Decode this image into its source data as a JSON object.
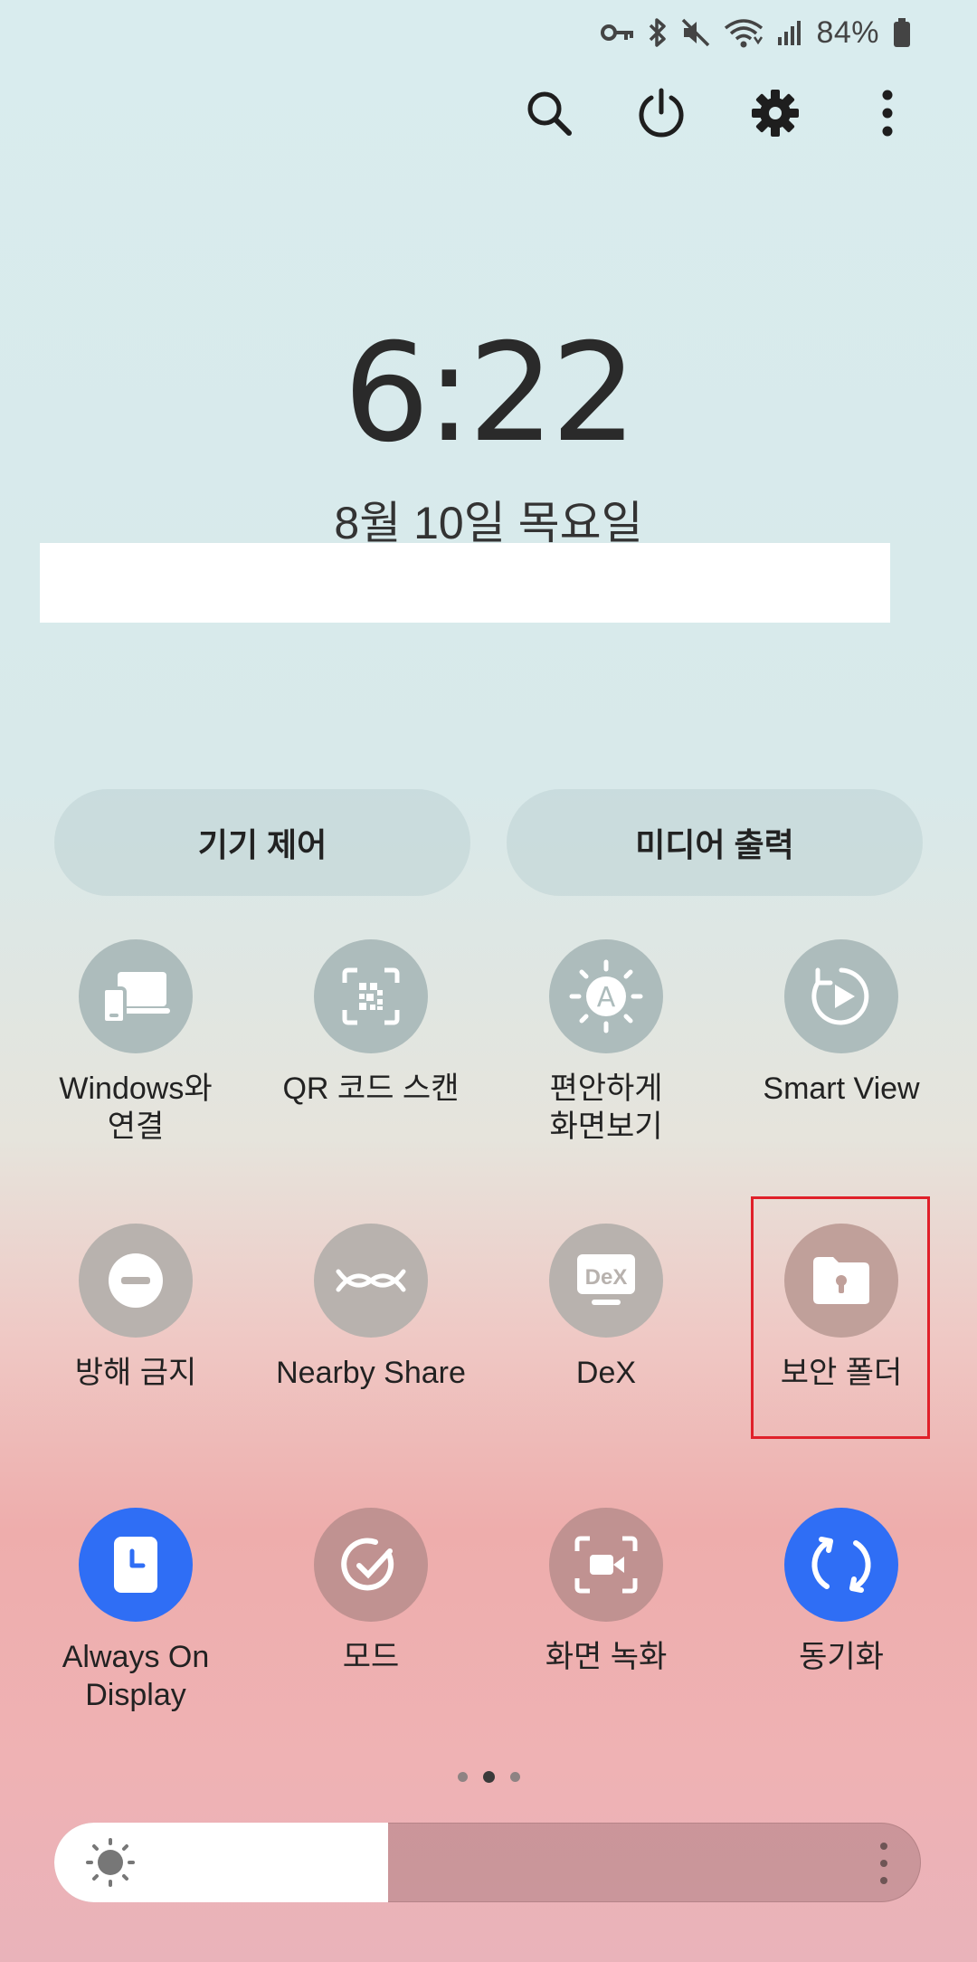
{
  "status_bar": {
    "battery_text": "84%",
    "icons": [
      "key-icon",
      "bluetooth-icon",
      "mute-icon",
      "wifi-icon",
      "signal-icon",
      "battery-icon"
    ]
  },
  "top_actions": [
    "search-icon",
    "power-icon",
    "settings-icon",
    "more-icon"
  ],
  "clock": {
    "time": "6:22",
    "date": "8월 10일 목요일"
  },
  "pills": {
    "device_control": "기기 제어",
    "media_output": "미디어 출력"
  },
  "tiles": [
    {
      "label": "Windows와\n연결",
      "icon": "link-to-windows-icon",
      "color": "#adbcbc"
    },
    {
      "label": "QR 코드 스캔",
      "icon": "qr-scan-icon",
      "color": "#adbcbc"
    },
    {
      "label": "편안하게\n화면보기",
      "icon": "eye-comfort-icon",
      "color": "#adbcbc"
    },
    {
      "label": "Smart View",
      "icon": "smart-view-icon",
      "color": "#adbcbc"
    },
    {
      "label": "방해 금지",
      "icon": "do-not-disturb-icon",
      "color": "#b8b2ae"
    },
    {
      "label": "Nearby Share",
      "icon": "nearby-share-icon",
      "color": "#b8b2ae"
    },
    {
      "label": "DeX",
      "icon": "dex-icon",
      "color": "#b8b2ae"
    },
    {
      "label": "보안 폴더",
      "icon": "secure-folder-icon",
      "color": "#c0a09a"
    },
    {
      "label": "Always On\nDisplay",
      "icon": "always-on-display-icon",
      "color": "#2f6ef5"
    },
    {
      "label": "모드",
      "icon": "modes-icon",
      "color": "#c09291"
    },
    {
      "label": "화면 녹화",
      "icon": "screen-recorder-icon",
      "color": "#c09291"
    },
    {
      "label": "동기화",
      "icon": "sync-icon",
      "color": "#2f6ef5"
    }
  ],
  "dex_badge": "DeX",
  "page_indicator": {
    "count": 3,
    "active": 2
  },
  "brightness": {
    "level": 0.385,
    "icons": [
      "sun-icon",
      "more-vert-icon"
    ]
  }
}
